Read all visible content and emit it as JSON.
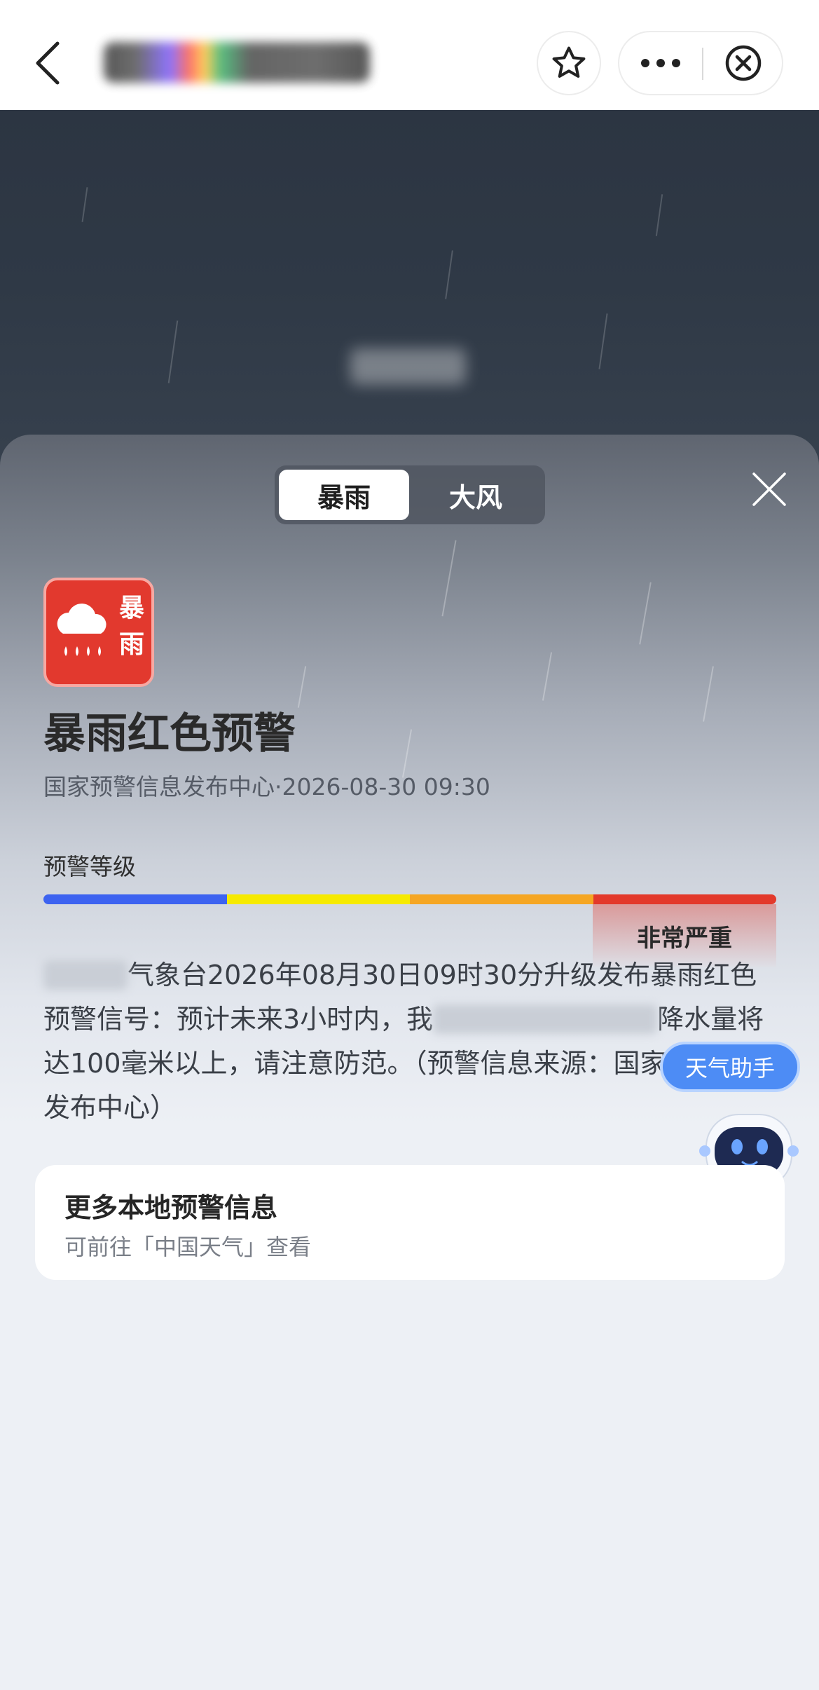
{
  "nav": {
    "title_blurred": "",
    "icons": {
      "back": "back-arrow-icon",
      "favorite": "star-icon",
      "more": "more-dots-icon",
      "close": "close-circle-icon"
    }
  },
  "tabs": [
    {
      "label": "暴雨",
      "active": true
    },
    {
      "label": "大风",
      "active": false
    }
  ],
  "warning": {
    "badge": {
      "line1": "暴",
      "line2": "雨",
      "color": "#e2392e",
      "icon": "rain-cloud-icon"
    },
    "title": "暴雨红色预警",
    "source": "国家预警信息发布中心·2026-08-30 09:30",
    "level_label": "预警等级",
    "levels": [
      {
        "color": "#3d63f0"
      },
      {
        "color": "#f6ea00"
      },
      {
        "color": "#f5a623"
      },
      {
        "color": "#e3392b"
      }
    ],
    "current_level_text": "非常严重",
    "current_level_index": 3,
    "body_parts": {
      "p1": "气象台2026年08月30日09时30分升级发布暴雨红色预警信号：预计未来3小时内，我",
      "p2": "降水量将达100毫米以上，请注意防范。（预警信息来源：国家预警信息发布中心）"
    }
  },
  "assistant": {
    "label": "天气助手"
  },
  "more_card": {
    "title": "更多本地预警信息",
    "subtitle": "可前往「中国天气」查看"
  }
}
